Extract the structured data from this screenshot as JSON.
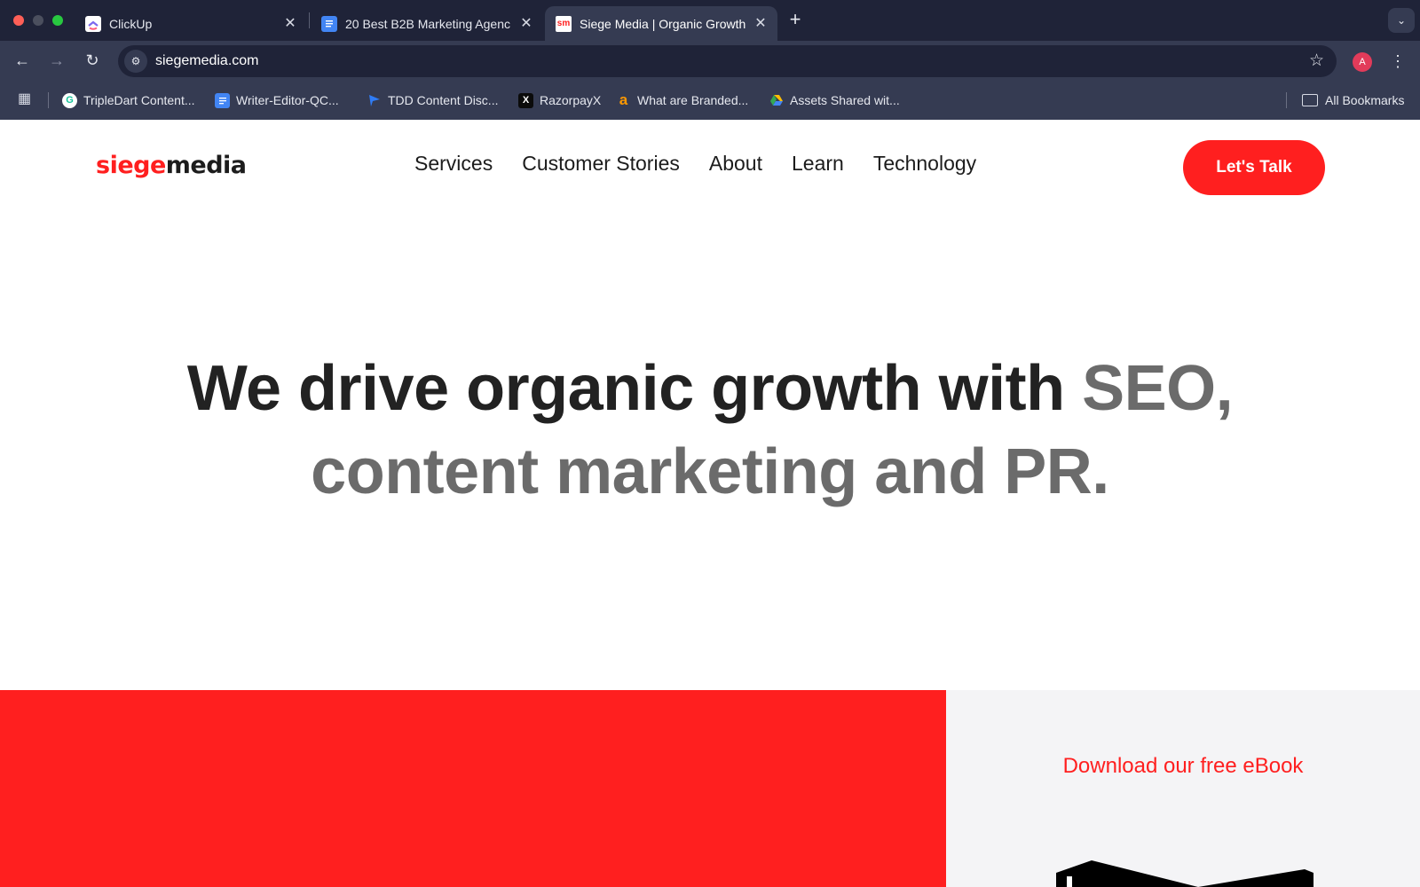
{
  "browser": {
    "tabs": [
      {
        "title": "ClickUp",
        "icon": "clickup-icon",
        "active": false
      },
      {
        "title": "20 Best B2B Marketing Agenc",
        "icon": "google-docs-icon",
        "active": false
      },
      {
        "title": "Siege Media | Organic Growth",
        "icon": "siege-media-favicon",
        "favicon_text": "sm",
        "active": true
      }
    ],
    "url": "siegemedia.com",
    "profile_initial": "A",
    "bookmarks": [
      {
        "label": "TripleDart Content...",
        "icon": "grammarly-icon",
        "glyph": "G"
      },
      {
        "label": "Writer-Editor-QC...",
        "icon": "google-docs-icon",
        "glyph": ""
      },
      {
        "label": "TDD Content Disc...",
        "icon": "flag-icon",
        "glyph": ""
      },
      {
        "label": "RazorpayX",
        "icon": "x-icon",
        "glyph": "X"
      },
      {
        "label": "What are Branded...",
        "icon": "amazon-icon",
        "glyph": "a"
      },
      {
        "label": "Assets Shared wit...",
        "icon": "google-drive-icon",
        "glyph": ""
      }
    ],
    "all_bookmarks_label": "All Bookmarks"
  },
  "site": {
    "logo": {
      "part1": "siege",
      "part2": "media"
    },
    "nav": [
      "Services",
      "Customer Stories",
      "About",
      "Learn",
      "Technology"
    ],
    "cta_label": "Let's Talk",
    "hero": {
      "dark": "We drive organic growth with ",
      "grey1": "SEO,",
      "grey2": "content marketing and PR."
    },
    "ebook_link": "Download our free eBook"
  },
  "colors": {
    "brand_red": "#ff1f1f",
    "tabstrip": "#1f2338",
    "toolbar": "#353b52"
  }
}
